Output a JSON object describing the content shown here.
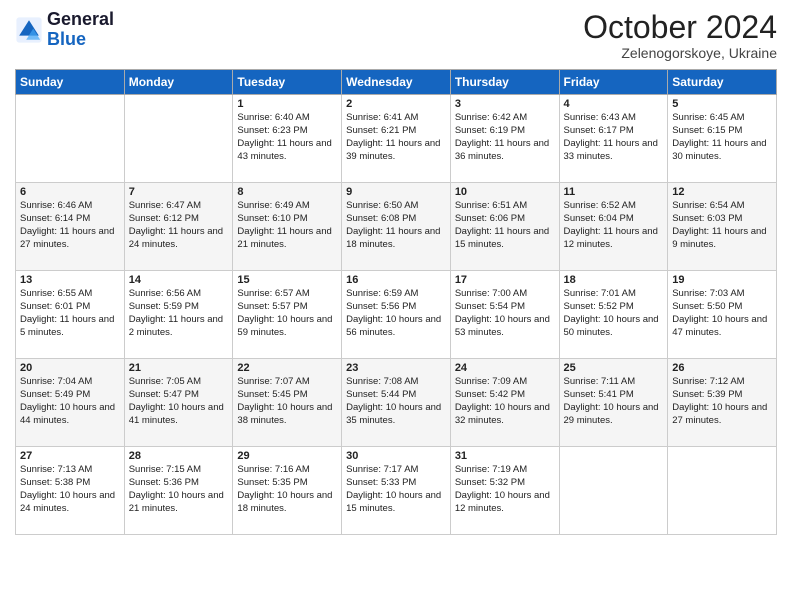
{
  "logo": {
    "line1": "General",
    "line2": "Blue"
  },
  "title": "October 2024",
  "location": "Zelenogorskoye, Ukraine",
  "days_header": [
    "Sunday",
    "Monday",
    "Tuesday",
    "Wednesday",
    "Thursday",
    "Friday",
    "Saturday"
  ],
  "weeks": [
    [
      {
        "num": "",
        "info": ""
      },
      {
        "num": "",
        "info": ""
      },
      {
        "num": "1",
        "info": "Sunrise: 6:40 AM\nSunset: 6:23 PM\nDaylight: 11 hours\nand 43 minutes."
      },
      {
        "num": "2",
        "info": "Sunrise: 6:41 AM\nSunset: 6:21 PM\nDaylight: 11 hours\nand 39 minutes."
      },
      {
        "num": "3",
        "info": "Sunrise: 6:42 AM\nSunset: 6:19 PM\nDaylight: 11 hours\nand 36 minutes."
      },
      {
        "num": "4",
        "info": "Sunrise: 6:43 AM\nSunset: 6:17 PM\nDaylight: 11 hours\nand 33 minutes."
      },
      {
        "num": "5",
        "info": "Sunrise: 6:45 AM\nSunset: 6:15 PM\nDaylight: 11 hours\nand 30 minutes."
      }
    ],
    [
      {
        "num": "6",
        "info": "Sunrise: 6:46 AM\nSunset: 6:14 PM\nDaylight: 11 hours\nand 27 minutes."
      },
      {
        "num": "7",
        "info": "Sunrise: 6:47 AM\nSunset: 6:12 PM\nDaylight: 11 hours\nand 24 minutes."
      },
      {
        "num": "8",
        "info": "Sunrise: 6:49 AM\nSunset: 6:10 PM\nDaylight: 11 hours\nand 21 minutes."
      },
      {
        "num": "9",
        "info": "Sunrise: 6:50 AM\nSunset: 6:08 PM\nDaylight: 11 hours\nand 18 minutes."
      },
      {
        "num": "10",
        "info": "Sunrise: 6:51 AM\nSunset: 6:06 PM\nDaylight: 11 hours\nand 15 minutes."
      },
      {
        "num": "11",
        "info": "Sunrise: 6:52 AM\nSunset: 6:04 PM\nDaylight: 11 hours\nand 12 minutes."
      },
      {
        "num": "12",
        "info": "Sunrise: 6:54 AM\nSunset: 6:03 PM\nDaylight: 11 hours\nand 9 minutes."
      }
    ],
    [
      {
        "num": "13",
        "info": "Sunrise: 6:55 AM\nSunset: 6:01 PM\nDaylight: 11 hours\nand 5 minutes."
      },
      {
        "num": "14",
        "info": "Sunrise: 6:56 AM\nSunset: 5:59 PM\nDaylight: 11 hours\nand 2 minutes."
      },
      {
        "num": "15",
        "info": "Sunrise: 6:57 AM\nSunset: 5:57 PM\nDaylight: 10 hours\nand 59 minutes."
      },
      {
        "num": "16",
        "info": "Sunrise: 6:59 AM\nSunset: 5:56 PM\nDaylight: 10 hours\nand 56 minutes."
      },
      {
        "num": "17",
        "info": "Sunrise: 7:00 AM\nSunset: 5:54 PM\nDaylight: 10 hours\nand 53 minutes."
      },
      {
        "num": "18",
        "info": "Sunrise: 7:01 AM\nSunset: 5:52 PM\nDaylight: 10 hours\nand 50 minutes."
      },
      {
        "num": "19",
        "info": "Sunrise: 7:03 AM\nSunset: 5:50 PM\nDaylight: 10 hours\nand 47 minutes."
      }
    ],
    [
      {
        "num": "20",
        "info": "Sunrise: 7:04 AM\nSunset: 5:49 PM\nDaylight: 10 hours\nand 44 minutes."
      },
      {
        "num": "21",
        "info": "Sunrise: 7:05 AM\nSunset: 5:47 PM\nDaylight: 10 hours\nand 41 minutes."
      },
      {
        "num": "22",
        "info": "Sunrise: 7:07 AM\nSunset: 5:45 PM\nDaylight: 10 hours\nand 38 minutes."
      },
      {
        "num": "23",
        "info": "Sunrise: 7:08 AM\nSunset: 5:44 PM\nDaylight: 10 hours\nand 35 minutes."
      },
      {
        "num": "24",
        "info": "Sunrise: 7:09 AM\nSunset: 5:42 PM\nDaylight: 10 hours\nand 32 minutes."
      },
      {
        "num": "25",
        "info": "Sunrise: 7:11 AM\nSunset: 5:41 PM\nDaylight: 10 hours\nand 29 minutes."
      },
      {
        "num": "26",
        "info": "Sunrise: 7:12 AM\nSunset: 5:39 PM\nDaylight: 10 hours\nand 27 minutes."
      }
    ],
    [
      {
        "num": "27",
        "info": "Sunrise: 7:13 AM\nSunset: 5:38 PM\nDaylight: 10 hours\nand 24 minutes."
      },
      {
        "num": "28",
        "info": "Sunrise: 7:15 AM\nSunset: 5:36 PM\nDaylight: 10 hours\nand 21 minutes."
      },
      {
        "num": "29",
        "info": "Sunrise: 7:16 AM\nSunset: 5:35 PM\nDaylight: 10 hours\nand 18 minutes."
      },
      {
        "num": "30",
        "info": "Sunrise: 7:17 AM\nSunset: 5:33 PM\nDaylight: 10 hours\nand 15 minutes."
      },
      {
        "num": "31",
        "info": "Sunrise: 7:19 AM\nSunset: 5:32 PM\nDaylight: 10 hours\nand 12 minutes."
      },
      {
        "num": "",
        "info": ""
      },
      {
        "num": "",
        "info": ""
      }
    ]
  ]
}
